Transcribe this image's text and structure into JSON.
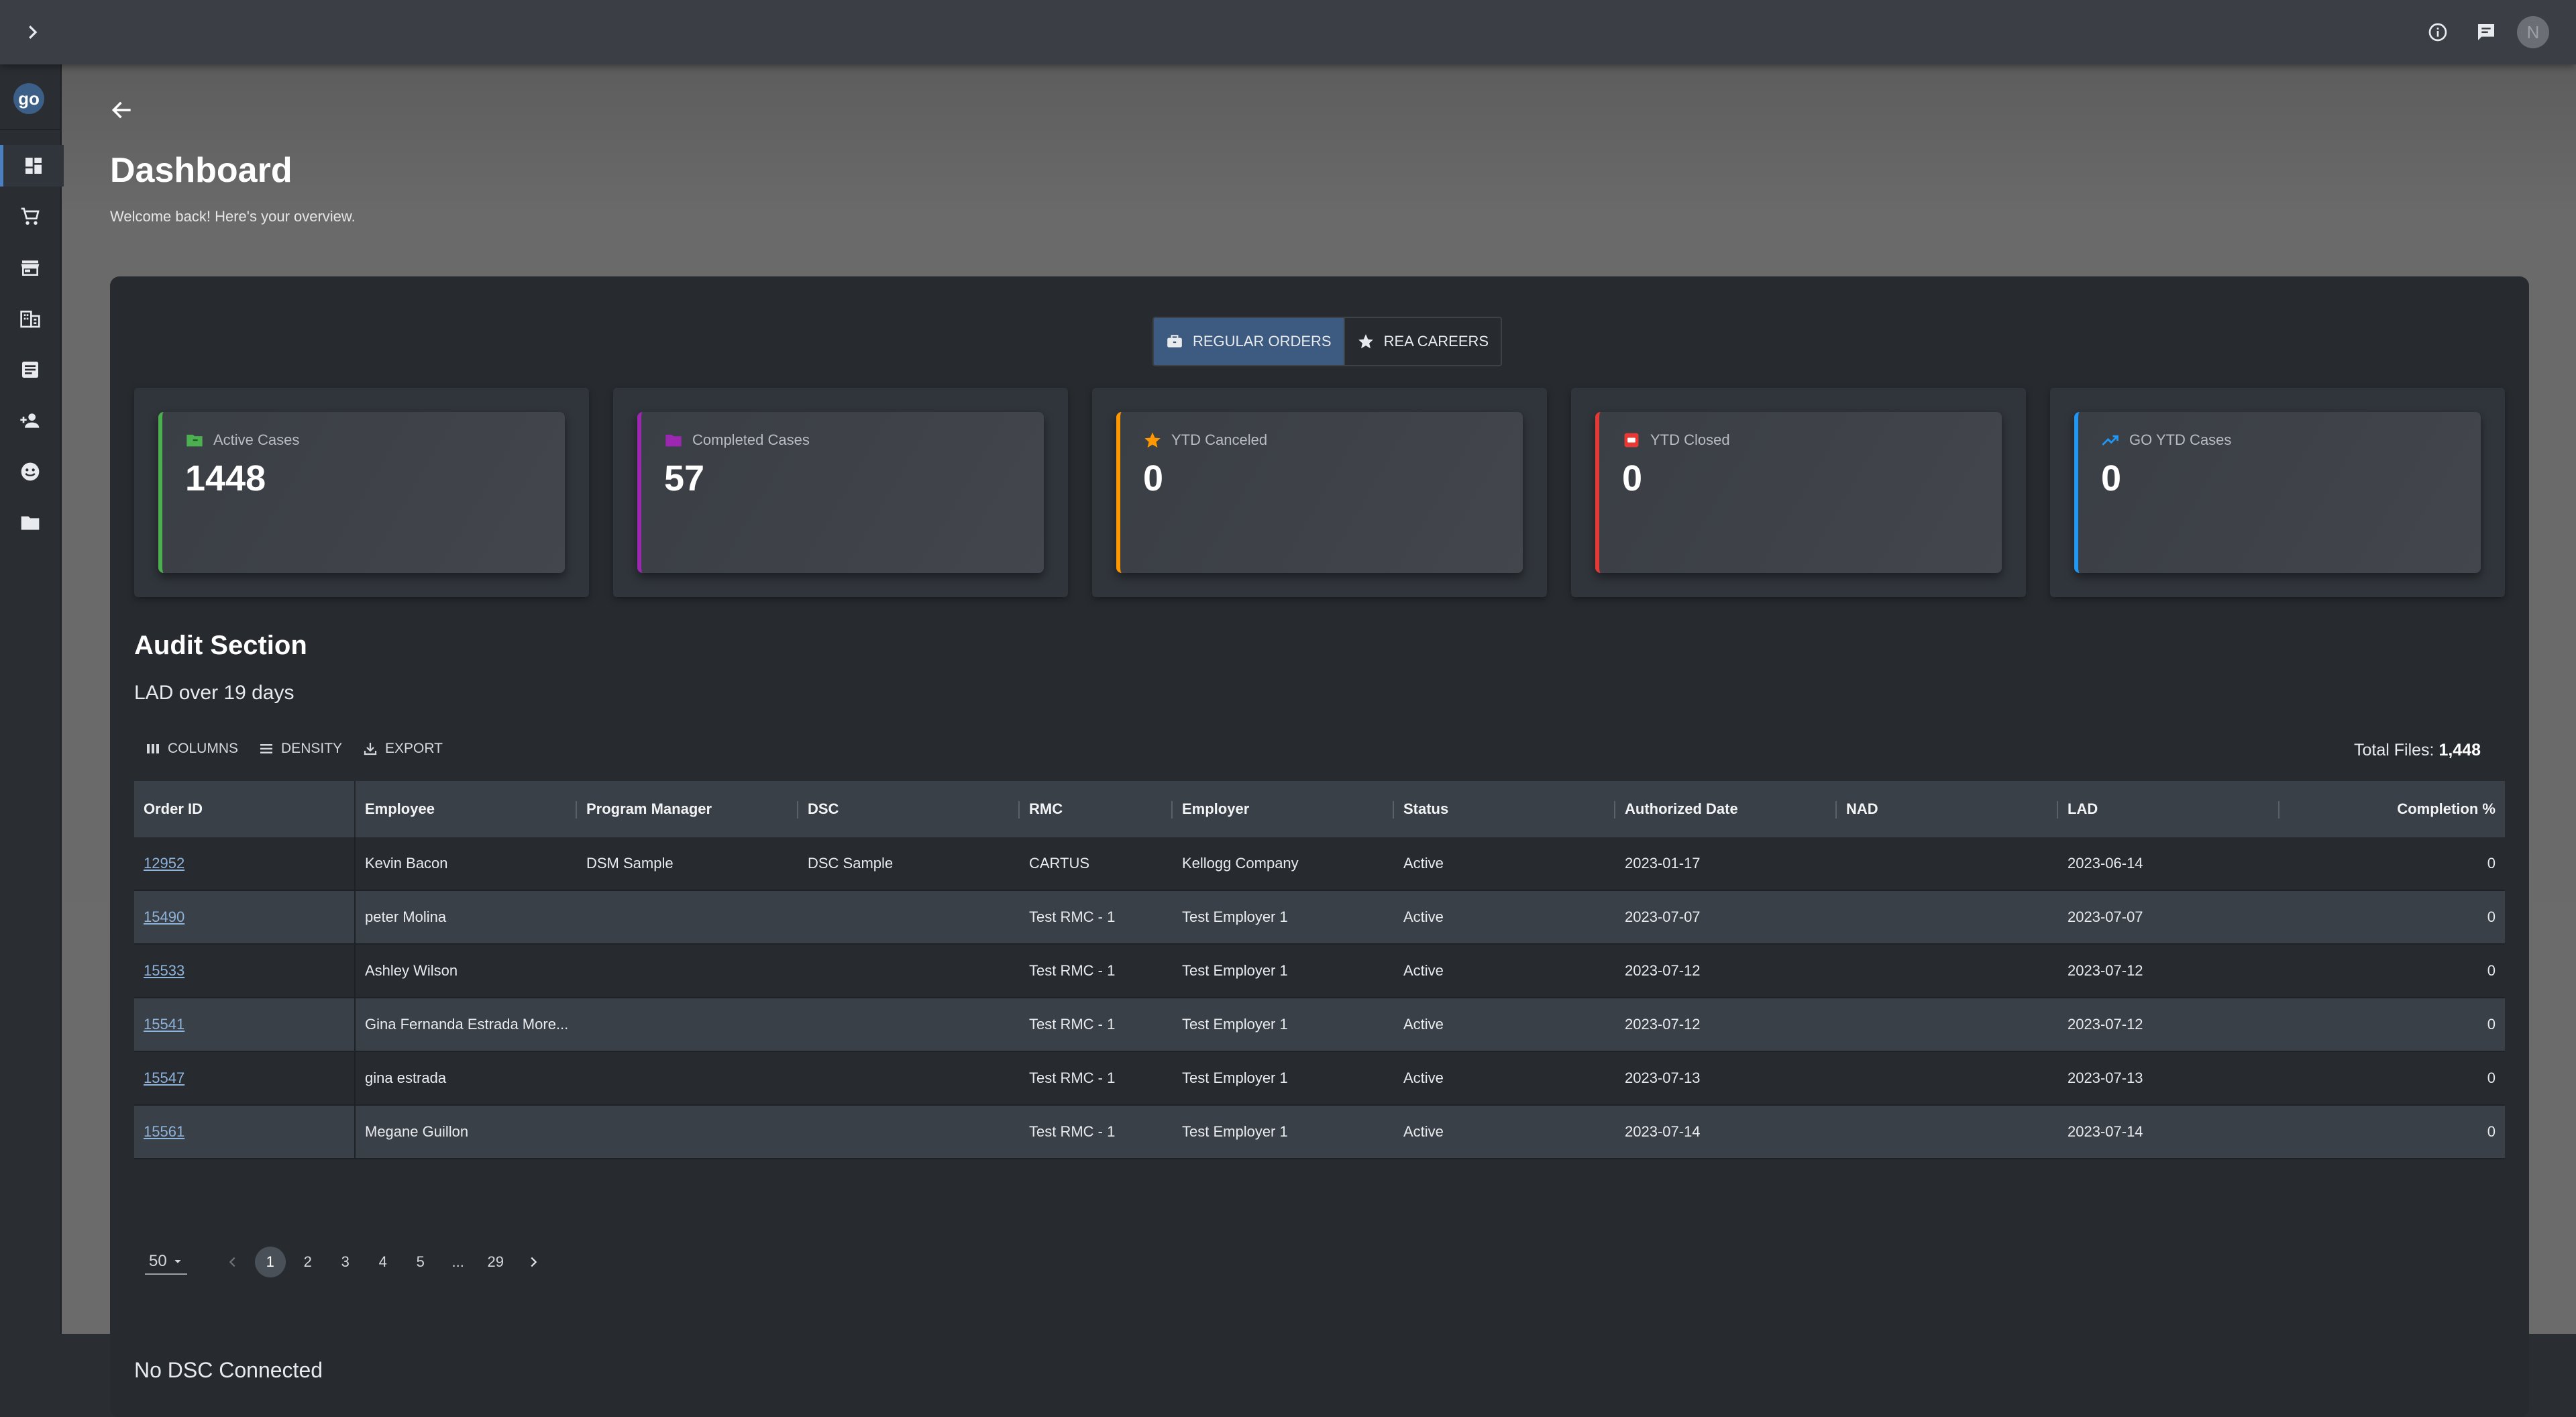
{
  "topbar": {
    "avatar_initial": "N"
  },
  "sidebar": {
    "logo": "go",
    "items": [
      "dashboard-icon",
      "cart-icon",
      "store-icon",
      "business-icon",
      "document-icon",
      "add-user-icon",
      "support-icon",
      "folder-icon"
    ]
  },
  "page": {
    "title": "Dashboard",
    "subtitle": "Welcome back! Here's your overview."
  },
  "toggle": {
    "regular": "REGULAR ORDERS",
    "rea": "REA CAREERS"
  },
  "cards": [
    {
      "label": "Active Cases",
      "value": "1448",
      "color": "#4caf50",
      "icon": "folder-icon"
    },
    {
      "label": "Completed Cases",
      "value": "57",
      "color": "#9c27b0",
      "icon": "folder-icon"
    },
    {
      "label": "YTD Canceled",
      "value": "0",
      "color": "#ff9800",
      "icon": "star-icon"
    },
    {
      "label": "YTD Closed",
      "value": "0",
      "color": "#e53935",
      "icon": "box-icon"
    },
    {
      "label": "GO YTD Cases",
      "value": "0",
      "color": "#2196f3",
      "icon": "trending-up-icon"
    }
  ],
  "audit": {
    "title": "Audit Section",
    "subtitle": "LAD over 19 days"
  },
  "toolbar": {
    "columns": "COLUMNS",
    "density": "DENSITY",
    "export": "EXPORT",
    "total_label": "Total Files: ",
    "total_value": "1,448"
  },
  "table": {
    "columns": [
      "Order ID",
      "Employee",
      "Program Manager",
      "DSC",
      "RMC",
      "Employer",
      "Status",
      "Authorized Date",
      "NAD",
      "LAD",
      "Completion %"
    ],
    "rows": [
      [
        "12952",
        "Kevin Bacon",
        "DSM Sample",
        "DSC Sample",
        "CARTUS",
        "Kellogg Company",
        "Active",
        "2023-01-17",
        "",
        "2023-06-14",
        "0"
      ],
      [
        "15490",
        "peter Molina",
        "",
        "",
        "Test RMC - 1",
        "Test Employer 1",
        "Active",
        "2023-07-07",
        "",
        "2023-07-07",
        "0"
      ],
      [
        "15533",
        "Ashley Wilson",
        "",
        "",
        "Test RMC - 1",
        "Test Employer 1",
        "Active",
        "2023-07-12",
        "",
        "2023-07-12",
        "0"
      ],
      [
        "15541",
        "Gina Fernanda Estrada More...",
        "",
        "",
        "Test RMC - 1",
        "Test Employer 1",
        "Active",
        "2023-07-12",
        "",
        "2023-07-12",
        "0"
      ],
      [
        "15547",
        "gina estrada",
        "",
        "",
        "Test RMC - 1",
        "Test Employer 1",
        "Active",
        "2023-07-13",
        "",
        "2023-07-13",
        "0"
      ],
      [
        "15561",
        "Megane Guillon",
        "",
        "",
        "Test RMC - 1",
        "Test Employer 1",
        "Active",
        "2023-07-14",
        "",
        "2023-07-14",
        "0"
      ]
    ]
  },
  "pager": {
    "page_size": "50",
    "pages": [
      "1",
      "2",
      "3",
      "4",
      "5",
      "...",
      "29"
    ],
    "current": "1"
  },
  "footer": {
    "no_dsc": "No DSC Connected"
  }
}
